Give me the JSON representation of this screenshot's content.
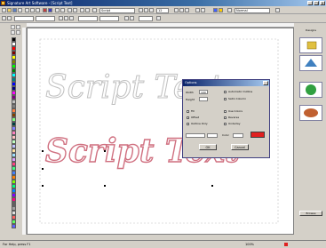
{
  "window": {
    "title": "Signature Art Software - [Script Text]",
    "minimize": "_",
    "maximize": "□",
    "close": "x"
  },
  "toolbar": {
    "font_value": "Script",
    "size_value": "12",
    "style_value": "Normal"
  },
  "canvas": {
    "sample_text_outline": "Script Text",
    "sample_text_filled": "Script Text",
    "outline_color": "#c0c0c0",
    "filled_color": "#d07080"
  },
  "dialog": {
    "title": "Options",
    "label_1": "Width",
    "label_2": "Height",
    "value_1": "100",
    "option_a": "Automatic Outline",
    "option_b": "Satin Column",
    "option_c": "Fill",
    "option_d": "Offset",
    "option_e": "Outline Only",
    "option_f": "Use Colors",
    "option_g": "Reverse",
    "option_h": "Underlay",
    "color_label": "Color",
    "ok": "OK",
    "cancel": "Cancel",
    "accent": "#e02020"
  },
  "right_panel": {
    "header": "Designs",
    "bottom_button": "Browse"
  },
  "status": {
    "text": "For Help, press F1",
    "zoom": "100%"
  },
  "palette": [
    "#000000",
    "#ffffff",
    "#ff0000",
    "#800000",
    "#ffff00",
    "#808000",
    "#00ff00",
    "#008000",
    "#00ffff",
    "#008080",
    "#0000ff",
    "#000080",
    "#ff00ff",
    "#800080",
    "#c0c0c0",
    "#808080",
    "#ff8040",
    "#804000",
    "#80ff80",
    "#004040",
    "#8080ff",
    "#ff80c0",
    "#ffc0c0",
    "#c0ffc0",
    "#c0c0ff",
    "#ffe0a0",
    "#a0e0ff",
    "#e0a0ff",
    "#ff4080",
    "#40ff80",
    "#4080ff",
    "#ff8000",
    "#80ff00",
    "#00ff80",
    "#0080ff",
    "#8000ff",
    "#ff0080",
    "#606060",
    "#a0a0a0",
    "#e0e0e0",
    "#ff6060",
    "#60ff60",
    "#6060ff"
  ]
}
